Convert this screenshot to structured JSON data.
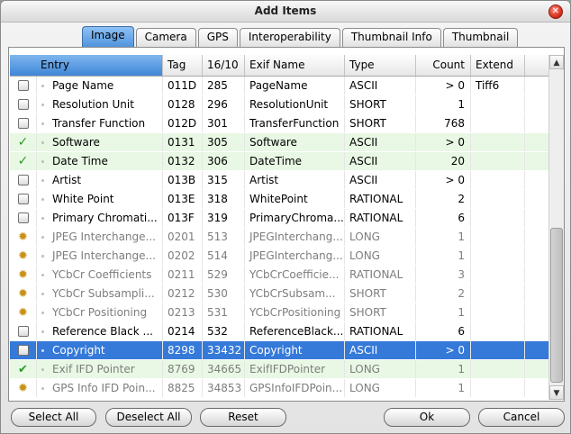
{
  "window": {
    "title": "Add Items"
  },
  "tabs": [
    {
      "label": "Image",
      "active": true
    },
    {
      "label": "Camera",
      "active": false
    },
    {
      "label": "GPS",
      "active": false
    },
    {
      "label": "Interoperability",
      "active": false
    },
    {
      "label": "Thumbnail Info",
      "active": false
    },
    {
      "label": "Thumbnail",
      "active": false
    }
  ],
  "columns": {
    "entry": "Entry",
    "tag": "Tag",
    "dec": "16/10",
    "exif_name": "Exif Name",
    "type": "Type",
    "count": "Count",
    "extend": "Extend"
  },
  "rows": [
    {
      "state": "unchecked",
      "entry": "Page Name",
      "tag": "011D",
      "dec": "285",
      "exif_name": "PageName",
      "type": "ASCII",
      "count": "> 0",
      "extend": "Tiff6",
      "style": "normal"
    },
    {
      "state": "unchecked",
      "entry": "Resolution Unit",
      "tag": "0128",
      "dec": "296",
      "exif_name": "ResolutionUnit",
      "type": "SHORT",
      "count": "1",
      "extend": "",
      "style": "normal"
    },
    {
      "state": "unchecked",
      "entry": "Transfer Function",
      "tag": "012D",
      "dec": "301",
      "exif_name": "TransferFunction",
      "type": "SHORT",
      "count": "768",
      "extend": "",
      "style": "normal"
    },
    {
      "state": "checked",
      "entry": "Software",
      "tag": "0131",
      "dec": "305",
      "exif_name": "Software",
      "type": "ASCII",
      "count": "> 0",
      "extend": "",
      "style": "green"
    },
    {
      "state": "checked",
      "entry": "Date Time",
      "tag": "0132",
      "dec": "306",
      "exif_name": "DateTime",
      "type": "ASCII",
      "count": "20",
      "extend": "",
      "style": "green"
    },
    {
      "state": "unchecked",
      "entry": "Artist",
      "tag": "013B",
      "dec": "315",
      "exif_name": "Artist",
      "type": "ASCII",
      "count": "> 0",
      "extend": "",
      "style": "normal"
    },
    {
      "state": "unchecked",
      "entry": "White Point",
      "tag": "013E",
      "dec": "318",
      "exif_name": "WhitePoint",
      "type": "RATIONAL",
      "count": "2",
      "extend": "",
      "style": "normal"
    },
    {
      "state": "unchecked",
      "entry": "Primary Chromati...",
      "tag": "013F",
      "dec": "319",
      "exif_name": "PrimaryChroma...",
      "type": "RATIONAL",
      "count": "6",
      "extend": "",
      "style": "normal"
    },
    {
      "state": "gear",
      "entry": "JPEG Interchange...",
      "tag": "0201",
      "dec": "513",
      "exif_name": "JPEGInterchang...",
      "type": "LONG",
      "count": "1",
      "extend": "",
      "style": "dim"
    },
    {
      "state": "gear",
      "entry": "JPEG Interchange...",
      "tag": "0202",
      "dec": "514",
      "exif_name": "JPEGInterchang...",
      "type": "LONG",
      "count": "1",
      "extend": "",
      "style": "dim"
    },
    {
      "state": "gear",
      "entry": "YCbCr Coefficients",
      "tag": "0211",
      "dec": "529",
      "exif_name": "YCbCrCoefficie...",
      "type": "RATIONAL",
      "count": "3",
      "extend": "",
      "style": "dim"
    },
    {
      "state": "gear",
      "entry": "YCbCr Subsampli...",
      "tag": "0212",
      "dec": "530",
      "exif_name": "YCbCrSubsam...",
      "type": "SHORT",
      "count": "2",
      "extend": "",
      "style": "dim"
    },
    {
      "state": "gear",
      "entry": "YCbCr Positioning",
      "tag": "0213",
      "dec": "531",
      "exif_name": "YCbCrPositioning",
      "type": "SHORT",
      "count": "1",
      "extend": "",
      "style": "dim"
    },
    {
      "state": "unchecked",
      "entry": "Reference Black ...",
      "tag": "0214",
      "dec": "532",
      "exif_name": "ReferenceBlack...",
      "type": "RATIONAL",
      "count": "6",
      "extend": "",
      "style": "normal"
    },
    {
      "state": "unchecked",
      "entry": "Copyright",
      "tag": "8298",
      "dec": "33432",
      "exif_name": "Copyright",
      "type": "ASCII",
      "count": "> 0",
      "extend": "",
      "style": "sel"
    },
    {
      "state": "gearcheck",
      "entry": "Exif IFD Pointer",
      "tag": "8769",
      "dec": "34665",
      "exif_name": "ExifIFDPointer",
      "type": "LONG",
      "count": "1",
      "extend": "",
      "style": "green dim"
    },
    {
      "state": "gear",
      "entry": "GPS Info IFD Poin...",
      "tag": "8825",
      "dec": "34853",
      "exif_name": "GPSInfoIFDPoin...",
      "type": "LONG",
      "count": "1",
      "extend": "",
      "style": "dim"
    }
  ],
  "buttons": {
    "select_all": "Select All",
    "deselect_all": "Deselect All",
    "reset": "Reset",
    "ok": "Ok",
    "cancel": "Cancel"
  },
  "icons": {
    "close": "close-icon",
    "checked": "check-icon",
    "gear": "gear-icon",
    "scroll_up": "arrow-up-icon",
    "scroll_down": "arrow-down-icon"
  },
  "colors": {
    "accent": "#3579d9",
    "checked_row": "#e8f8e4",
    "header_active": "#4f94dd"
  }
}
